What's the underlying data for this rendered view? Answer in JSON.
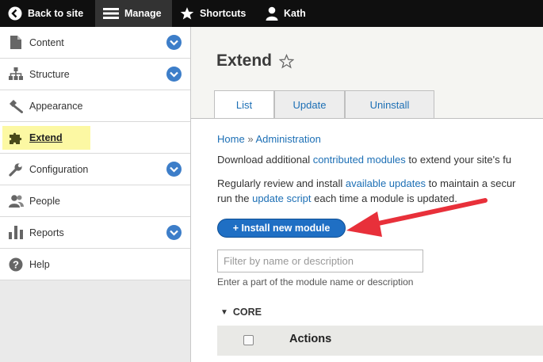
{
  "toolbar": {
    "back": "Back to site",
    "manage": "Manage",
    "shortcuts": "Shortcuts",
    "user": "Kath"
  },
  "sidebar": {
    "items": [
      {
        "label": "Content",
        "icon": "file-icon",
        "expandable": true
      },
      {
        "label": "Structure",
        "icon": "sitemap-icon",
        "expandable": true
      },
      {
        "label": "Appearance",
        "icon": "paintbrush-icon",
        "expandable": false
      },
      {
        "label": "Extend",
        "icon": "puzzle-icon",
        "expandable": false,
        "active": true
      },
      {
        "label": "Configuration",
        "icon": "wrench-icon",
        "expandable": true
      },
      {
        "label": "People",
        "icon": "people-icon",
        "expandable": false
      },
      {
        "label": "Reports",
        "icon": "bar-chart-icon",
        "expandable": true
      },
      {
        "label": "Help",
        "icon": "help-icon",
        "expandable": false
      }
    ]
  },
  "page": {
    "title": "Extend",
    "tabs": [
      "List",
      "Update",
      "Uninstall"
    ],
    "breadcrumb": {
      "home": "Home",
      "separator": "»",
      "admin": "Administration"
    },
    "para1": {
      "pre": "Download additional ",
      "link": "contributed modules",
      "post": " to extend your site's fu"
    },
    "para2": {
      "pre": "Regularly review and install ",
      "link": "available updates",
      "post": " to maintain a secur"
    },
    "para3": {
      "pre": "run the ",
      "link": "update script",
      "post": " each time a module is updated."
    },
    "install_button": "+ Install new module",
    "filter_placeholder": "Filter by name or description",
    "filter_help": "Enter a part of the module name or description",
    "section": "CORE",
    "section_toggle": "▼",
    "table_header": "Actions"
  },
  "colors": {
    "toolbar_bg": "#0f0f0f",
    "link": "#1c6fb5",
    "button": "#1f6fc4",
    "highlight": "#fcf8a3",
    "annotation_arrow": "#e8303a"
  }
}
